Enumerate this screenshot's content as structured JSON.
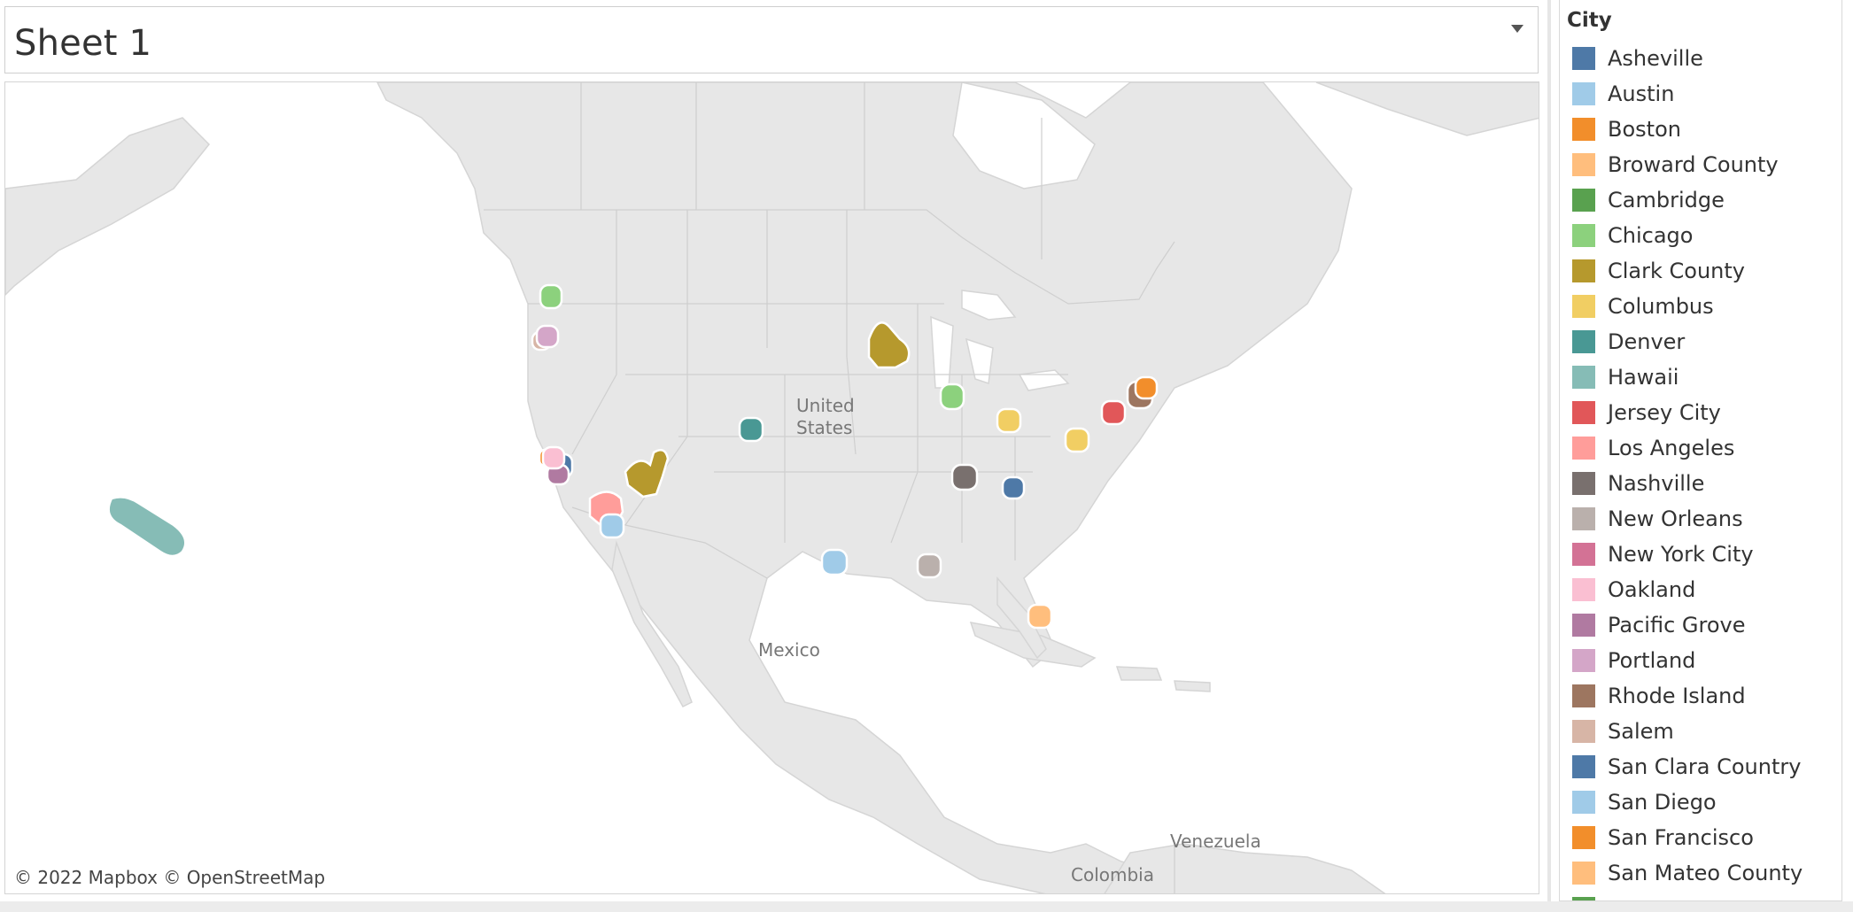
{
  "sheet": {
    "title": "Sheet 1"
  },
  "map": {
    "attribution": "© 2022 Mapbox  © OpenStreetMap",
    "labels": {
      "us": [
        "United",
        "States"
      ],
      "mexico": "Mexico",
      "venezuela": "Venezuela",
      "colombia": "Colombia"
    }
  },
  "legend": {
    "title": "City",
    "items": [
      {
        "label": "Asheville",
        "color": "#4e79a7"
      },
      {
        "label": "Austin",
        "color": "#a0cbe8"
      },
      {
        "label": "Boston",
        "color": "#f28e2b"
      },
      {
        "label": "Broward County",
        "color": "#ffbe7d"
      },
      {
        "label": "Cambridge",
        "color": "#59a14f"
      },
      {
        "label": "Chicago",
        "color": "#8cd17d"
      },
      {
        "label": "Clark County",
        "color": "#b6992d"
      },
      {
        "label": "Columbus",
        "color": "#f1ce63"
      },
      {
        "label": "Denver",
        "color": "#499894"
      },
      {
        "label": "Hawaii",
        "color": "#86bcb6"
      },
      {
        "label": "Jersey City",
        "color": "#e15759"
      },
      {
        "label": "Los Angeles",
        "color": "#ff9d9a"
      },
      {
        "label": "Nashville",
        "color": "#79706e"
      },
      {
        "label": "New Orleans",
        "color": "#bab0ac"
      },
      {
        "label": "New York City",
        "color": "#d37295"
      },
      {
        "label": "Oakland",
        "color": "#fabfd2"
      },
      {
        "label": "Pacific Grove",
        "color": "#b07aa1"
      },
      {
        "label": "Portland",
        "color": "#d4a6c8"
      },
      {
        "label": "Rhode Island",
        "color": "#9d7660"
      },
      {
        "label": "Salem",
        "color": "#d7b5a6"
      },
      {
        "label": "San Clara Country",
        "color": "#4e79a7"
      },
      {
        "label": "San Diego",
        "color": "#a0cbe8"
      },
      {
        "label": "San Francisco",
        "color": "#f28e2b"
      },
      {
        "label": "San Mateo County",
        "color": "#ffbe7d"
      },
      {
        "label": "",
        "color": "#59a14f"
      }
    ]
  }
}
